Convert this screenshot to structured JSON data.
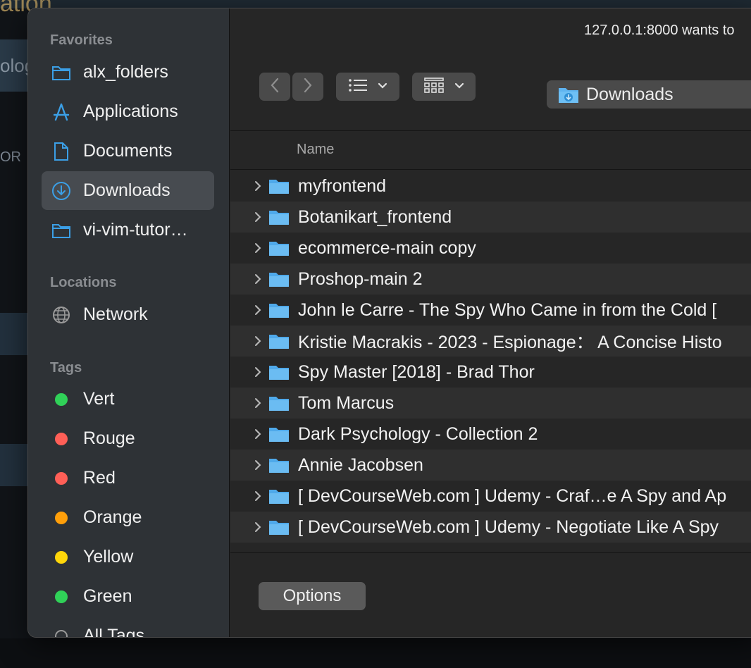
{
  "background": {
    "title_fragment": "ation",
    "band_fragment": "olog",
    "side_fragment": "OR"
  },
  "dialog": {
    "prompt": "127.0.0.1:8000 wants to",
    "toolbar": {
      "back_icon": "chevron-left-icon",
      "forward_icon": "chevron-right-icon",
      "list_view_icon": "list-view-icon",
      "group_icon": "grid-view-icon",
      "location": "Downloads"
    },
    "sidebar": {
      "favorites_header": "Favorites",
      "favorites": [
        {
          "label": "alx_folders",
          "icon": "folder-icon"
        },
        {
          "label": "Applications",
          "icon": "applications-icon"
        },
        {
          "label": "Documents",
          "icon": "document-icon"
        },
        {
          "label": "Downloads",
          "icon": "download-icon",
          "selected": true
        },
        {
          "label": "vi-vim-tutor…",
          "icon": "folder-icon"
        }
      ],
      "locations_header": "Locations",
      "locations": [
        {
          "label": "Network",
          "icon": "globe-icon"
        }
      ],
      "tags_header": "Tags",
      "tags": [
        {
          "label": "Vert",
          "color": "#30d158"
        },
        {
          "label": "Rouge",
          "color": "#ff5f57"
        },
        {
          "label": "Red",
          "color": "#ff5f57"
        },
        {
          "label": "Orange",
          "color": "#ff9f0a"
        },
        {
          "label": "Yellow",
          "color": "#ffd60a"
        },
        {
          "label": "Green",
          "color": "#30d158"
        },
        {
          "label": "All Tags",
          "color": ""
        }
      ]
    },
    "column_header": "Name",
    "files": [
      "myfrontend",
      "Botanikart_frontend",
      "ecommerce-main copy",
      "Proshop-main 2",
      "John le Carre - The Spy Who Came in from the Cold [",
      "Kristie Macrakis - 2023 - Espionage： A Concise Histo",
      "Spy Master [2018] - Brad Thor",
      "Tom Marcus",
      "Dark Psychology - Collection 2",
      "Annie Jacobsen",
      "[ DevCourseWeb.com ] Udemy - Craf…e A Spy and Ap",
      "[ DevCourseWeb.com ] Udemy - Negotiate Like A Spy"
    ],
    "options_label": "Options",
    "accent_color": "#3b9fe6"
  }
}
